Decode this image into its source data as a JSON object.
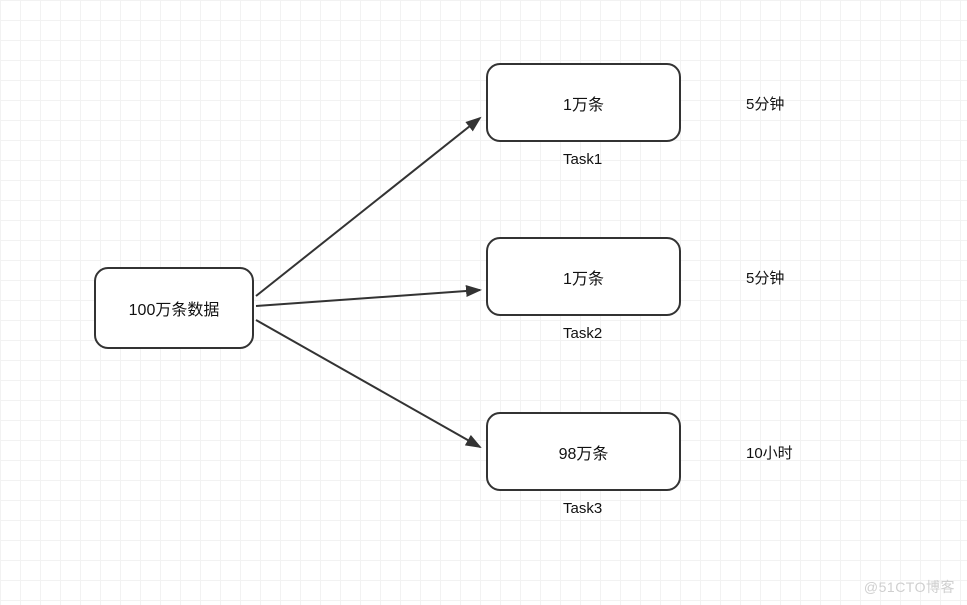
{
  "source": {
    "label": "100万条数据"
  },
  "tasks": [
    {
      "box_label": "1万条",
      "name": "Task1",
      "time": "5分钟"
    },
    {
      "box_label": "1万条",
      "name": "Task2",
      "time": "5分钟"
    },
    {
      "box_label": "98万条",
      "name": "Task3",
      "time": "10小时"
    }
  ],
  "watermark": "@51CTO博客"
}
